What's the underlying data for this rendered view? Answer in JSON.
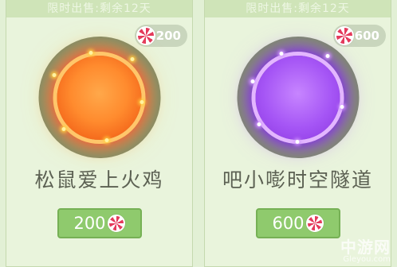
{
  "items": [
    {
      "sale_text": "限时出售:剩余12天",
      "price": "200",
      "name": "松鼠爱上火鸡",
      "effect_color": "#ff8b2e",
      "currency_icon": "candy-icon"
    },
    {
      "sale_text": "限时出售:剩余12天",
      "price": "600",
      "name": "吧小嘭时空隧道",
      "effect_color": "#a555f5",
      "currency_icon": "candy-icon"
    }
  ],
  "watermark": {
    "cn": "中游网",
    "en": "Gleyou.com"
  }
}
